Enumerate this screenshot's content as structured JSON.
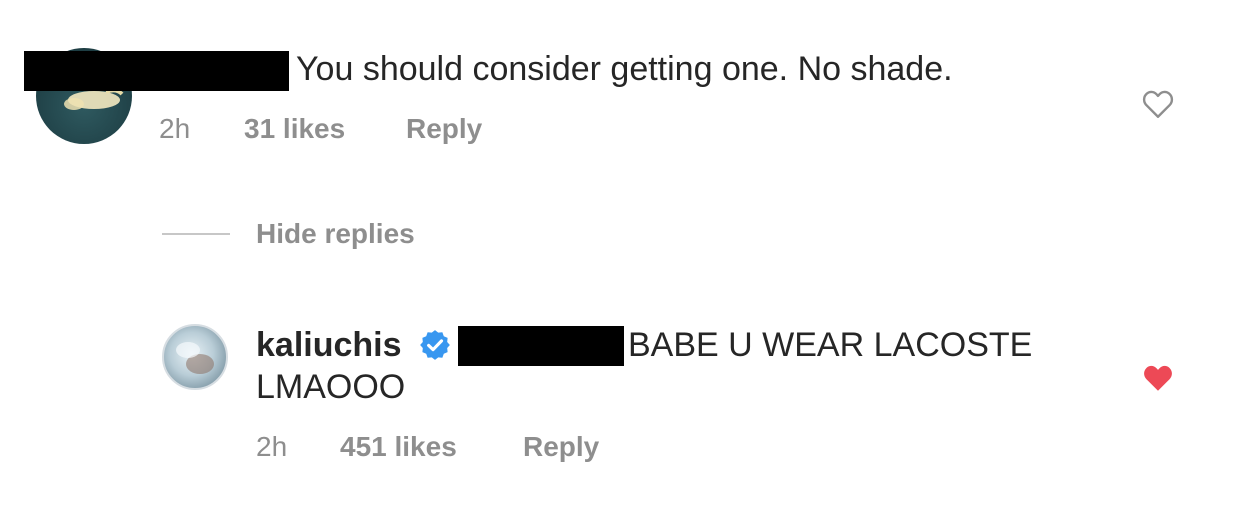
{
  "comment": {
    "text": "You should consider getting one. No shade.",
    "time": "2h",
    "likes": "31 likes",
    "reply_label": "Reply",
    "liked": false
  },
  "replies_toggle": {
    "label": "Hide replies"
  },
  "reply": {
    "username": "kaliuchis",
    "verified": true,
    "text_line1": "BABE U WEAR LACOSTE",
    "text_line2": "LMAOOO",
    "time": "2h",
    "likes": "451 likes",
    "reply_label": "Reply",
    "liked": true
  },
  "colors": {
    "text": "#262626",
    "muted": "#8e8e8e",
    "verified_blue": "#3897f0",
    "like_red": "#ed4956"
  },
  "icons": {
    "verified": "verified-badge-icon",
    "heart_outline": "heart-outline-icon",
    "heart_filled": "heart-filled-icon"
  }
}
